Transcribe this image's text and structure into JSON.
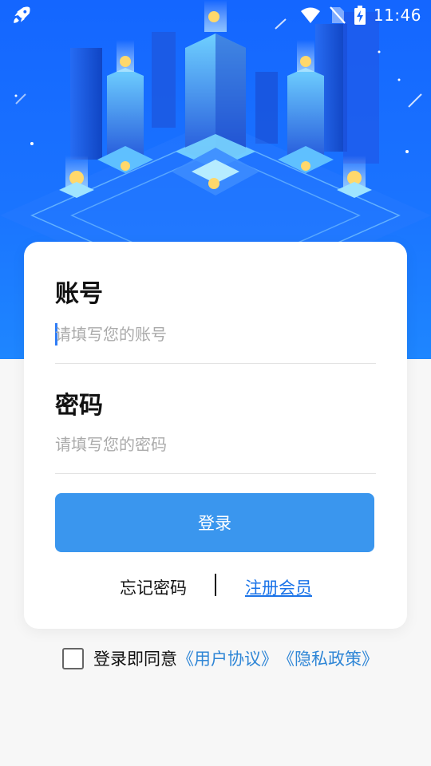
{
  "status_bar": {
    "time": "11:46",
    "icons": [
      "rocket-icon",
      "wifi-icon",
      "no-sim-icon",
      "battery-charging-icon"
    ]
  },
  "login_card": {
    "account_label": "账号",
    "account_placeholder": "请填写您的账号",
    "password_label": "密码",
    "password_placeholder": "请填写您的密码",
    "login_button": "登录",
    "forgot_password": "忘记密码",
    "register": "注册会员"
  },
  "agreement": {
    "checked": false,
    "prefix": "登录即同意",
    "user_agreement": "《用户协议》",
    "privacy_policy": "《隐私政策》"
  },
  "colors": {
    "hero_blue": "#1466ff",
    "button_blue": "#3a96ee",
    "link_blue": "#1a73e8"
  }
}
